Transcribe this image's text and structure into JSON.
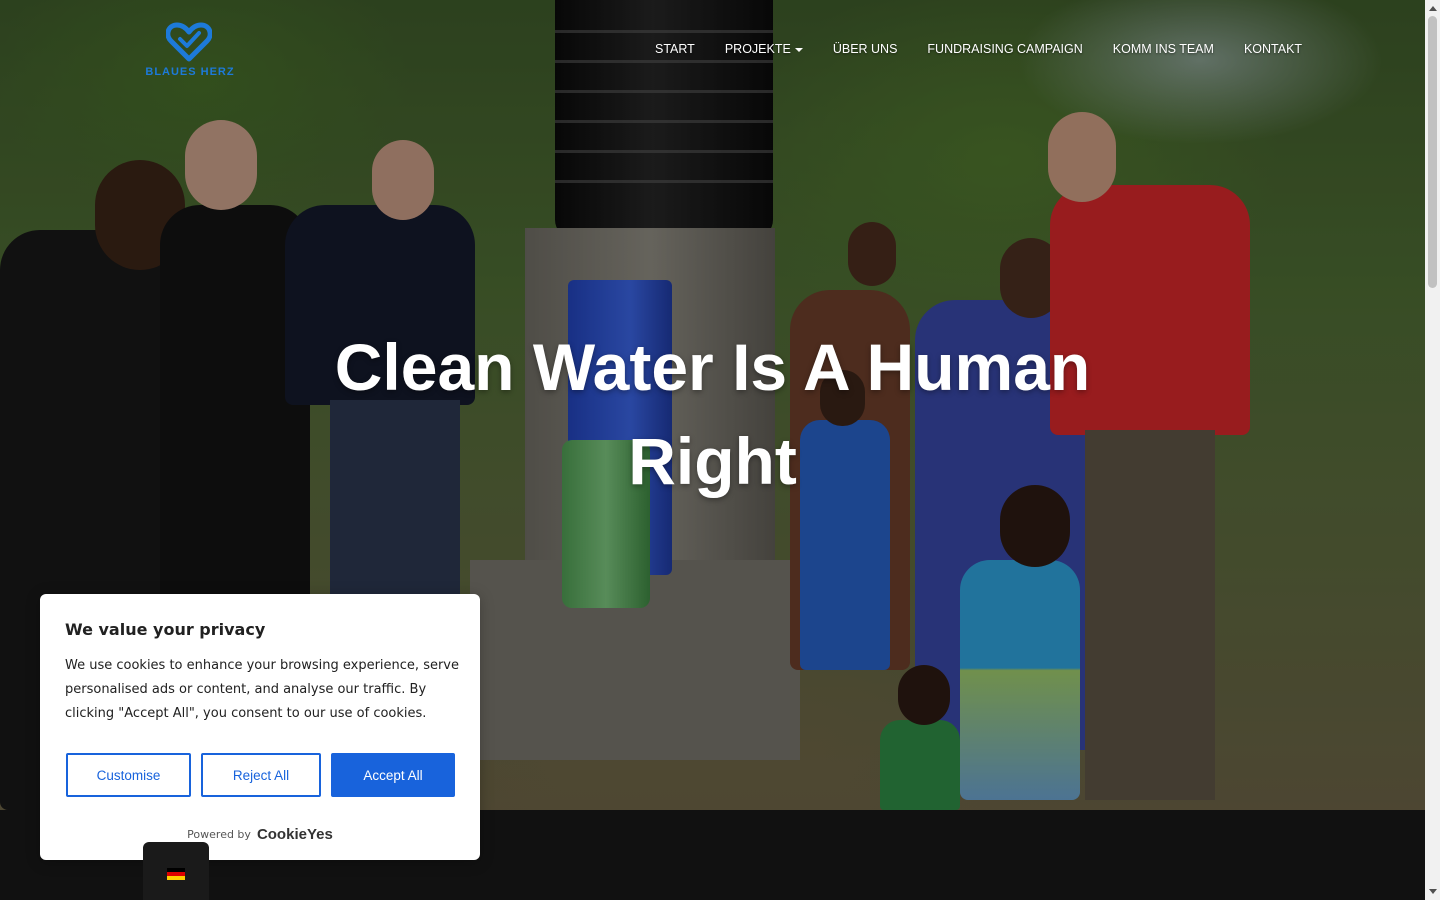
{
  "brand": {
    "logo_text": "BLAUES HERZ",
    "color": "#1d7ad9"
  },
  "nav": {
    "items": [
      {
        "label": "START"
      },
      {
        "label": "PROJEKTE",
        "has_dropdown": true
      },
      {
        "label": "ÜBER UNS"
      },
      {
        "label": "FUNDRAISING CAMPAIGN"
      },
      {
        "label": "KOMM INS TEAM"
      },
      {
        "label": "KONTAKT"
      }
    ]
  },
  "hero": {
    "headline": "Clean Water Is A Human Right"
  },
  "cookie_banner": {
    "title": "We value your privacy",
    "text": "We use cookies to enhance your browsing experience, serve personalised ads or content, and analyse our traffic. By clicking \"Accept All\", you consent to our use of cookies.",
    "buttons": {
      "customise": "Customise",
      "reject": "Reject All",
      "accept": "Accept All"
    },
    "powered_by": "Powered by",
    "provider": "CookieYes",
    "accent_color": "#1863dc"
  },
  "language_switcher": {
    "current": "de",
    "icon": "germany-flag-icon"
  }
}
